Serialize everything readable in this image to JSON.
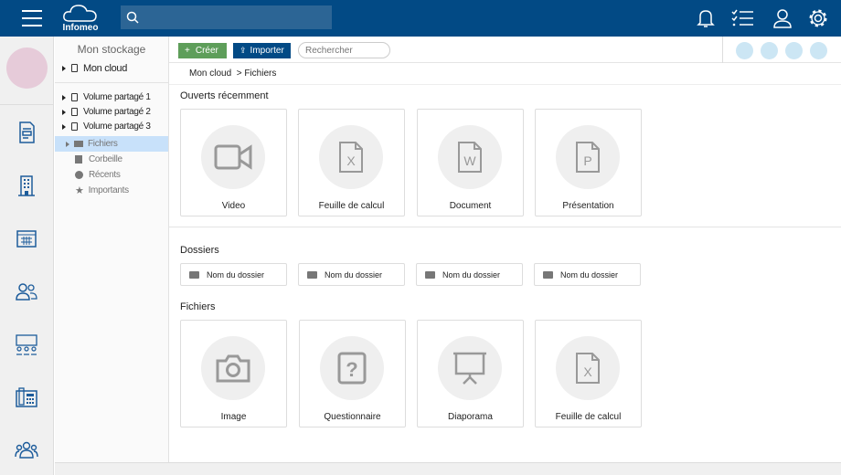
{
  "header": {
    "logo": "Infomeo",
    "search_placeholder": ""
  },
  "tree": {
    "title": "Mon stockage",
    "root": "Mon cloud",
    "volumes": [
      "Volume partagé 1",
      "Volume partagé 2",
      "Volume partagé 3"
    ],
    "sub": [
      "Fichiers",
      "Corbeille",
      "Récents",
      "Importants"
    ]
  },
  "toolbar": {
    "create": "Créer",
    "import": "Importer",
    "search_placeholder": "Rechercher"
  },
  "breadcrumb": {
    "root": "Mon cloud",
    "sep": ">",
    "current": "Fichiers"
  },
  "recent": {
    "title": "Ouverts récemment",
    "items": [
      "Video",
      "Feuille de calcul",
      "Document",
      "Présentation"
    ]
  },
  "folders": {
    "title": "Dossiers",
    "items": [
      "Nom du dossier",
      "Nom du dossier",
      "Nom du dossier",
      "Nom du dossier"
    ]
  },
  "files": {
    "title": "Fichiers",
    "items": [
      "Image",
      "Questionnaire",
      "Diaporama",
      "Feuille de calcul"
    ]
  },
  "colors": {
    "header": "#024a85",
    "create": "#5e9e5a",
    "import": "#024a85",
    "selected": "#c8e1fa"
  }
}
